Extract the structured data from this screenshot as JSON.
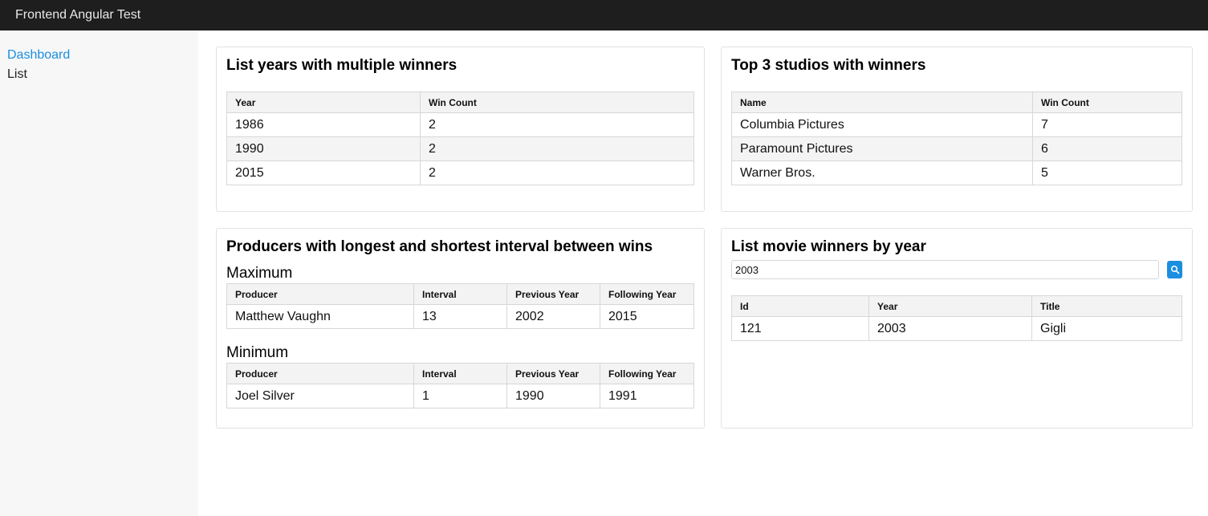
{
  "app": {
    "title": "Frontend Angular Test"
  },
  "sidebar": {
    "items": [
      {
        "label": "Dashboard",
        "active": true
      },
      {
        "label": "List",
        "active": false
      }
    ]
  },
  "multiple_winners": {
    "title": "List years with multiple winners",
    "columns": [
      "Year",
      "Win Count"
    ],
    "rows": [
      [
        "1986",
        "2"
      ],
      [
        "1990",
        "2"
      ],
      [
        "2015",
        "2"
      ]
    ]
  },
  "studios": {
    "title": "Top 3 studios with winners",
    "columns": [
      "Name",
      "Win Count"
    ],
    "rows": [
      [
        "Columbia Pictures",
        "7"
      ],
      [
        "Paramount Pictures",
        "6"
      ],
      [
        "Warner Bros.",
        "5"
      ]
    ]
  },
  "producers": {
    "title": "Producers with longest and shortest interval between wins",
    "maximum": {
      "heading": "Maximum",
      "columns": [
        "Producer",
        "Interval",
        "Previous Year",
        "Following Year"
      ],
      "rows": [
        [
          "Matthew Vaughn",
          "13",
          "2002",
          "2015"
        ]
      ]
    },
    "minimum": {
      "heading": "Minimum",
      "columns": [
        "Producer",
        "Interval",
        "Previous Year",
        "Following Year"
      ],
      "rows": [
        [
          "Joel Silver",
          "1",
          "1990",
          "1991"
        ]
      ]
    }
  },
  "winners_by_year": {
    "title": "List movie winners by year",
    "search_value": "2003",
    "search_icon": "search-icon",
    "columns": [
      "Id",
      "Year",
      "Title"
    ],
    "rows": [
      [
        "121",
        "2003",
        "Gigli"
      ]
    ]
  },
  "colors": {
    "accent": "#1a8fe0",
    "topbar": "#1e1e1e",
    "sidebar": "#f7f7f8"
  }
}
